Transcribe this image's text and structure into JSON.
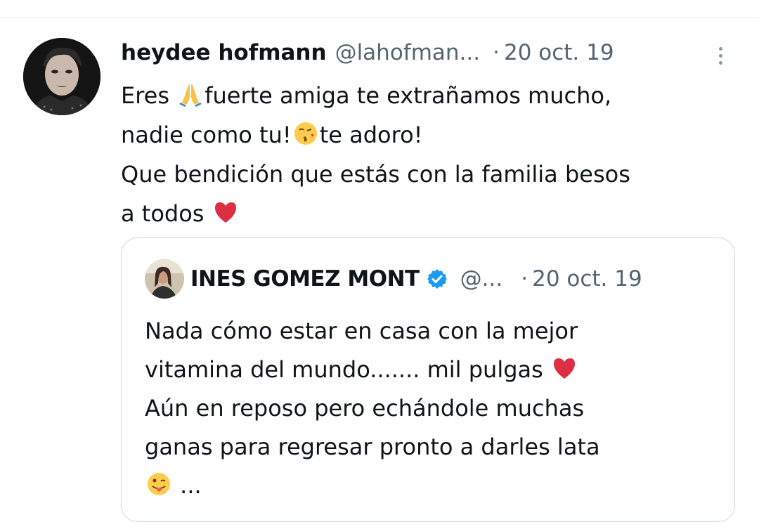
{
  "tweet": {
    "author": {
      "display_name": "heydee hofmann",
      "handle": "@lahofman...",
      "avatar": "profile-photo"
    },
    "separator": "·",
    "date": "20 oct. 19",
    "more_icon": "more-options-icon",
    "text_lines": [
      {
        "before": "Eres ",
        "emoji": "folded-hands-emoji",
        "after": "fuerte amiga te extrañamos mucho,"
      },
      {
        "before": "nadie como tu!",
        "emoji": "face-blowing-kiss-emoji",
        "after": "te adoro!"
      },
      {
        "before": "Que bendición que estás con la familia besos",
        "emoji": "",
        "after": ""
      },
      {
        "before": "a todos ",
        "emoji": "red-heart-emoji",
        "after": ""
      }
    ]
  },
  "quoted_tweet": {
    "author": {
      "display_name": "INES GOMEZ MONT",
      "verified_icon": "verified-badge-icon",
      "handle": "@...",
      "avatar": "profile-photo"
    },
    "separator": "·",
    "date": "20 oct. 19",
    "text_lines": [
      {
        "before": "Nada cómo estar en casa con la mejor",
        "emoji": "",
        "after": ""
      },
      {
        "before": "vitamina del mundo....... mil pulgas ",
        "emoji": "red-heart-emoji",
        "after": ""
      },
      {
        "before": "Aún en reposo pero echándole muchas",
        "emoji": "",
        "after": ""
      },
      {
        "before": "ganas para regresar pronto  a darles lata",
        "emoji": "",
        "after": ""
      },
      {
        "before": "",
        "emoji": "winking-face-with-tongue-emoji",
        "after": " ..."
      }
    ]
  },
  "colors": {
    "text_primary": "#0f1419",
    "text_secondary": "#536471",
    "border": "#cfd9de",
    "verified_blue": "#1d9bf0",
    "heart_red": "#dd2e44"
  }
}
